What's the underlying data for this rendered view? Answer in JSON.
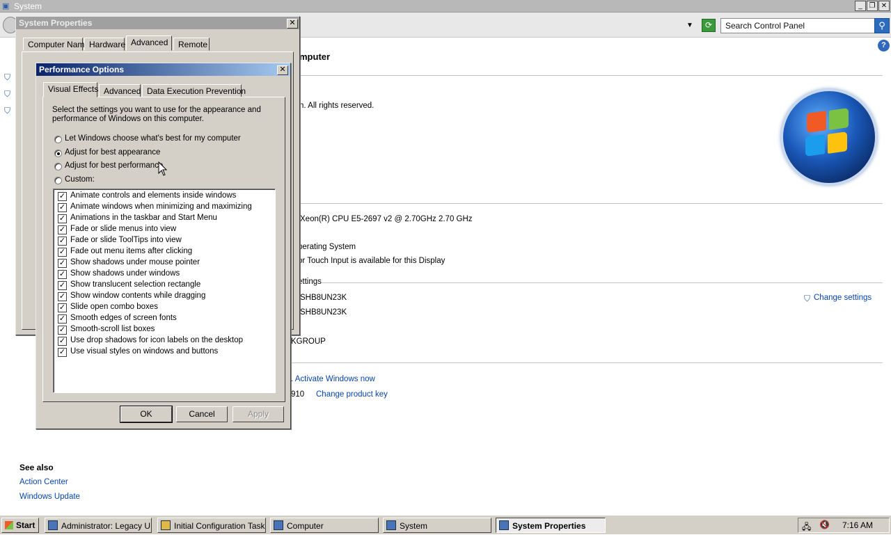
{
  "system_window": {
    "title": "System",
    "minimize_glyph": "_",
    "maximize_glyph": "❐",
    "close_glyph": "✕",
    "search_placeholder": "Search Control Panel",
    "header_fragment": "mputer",
    "copyright_fragment": "n.  All rights reserved.",
    "processor_fragment": "Xeon(R) CPU E5-2697 v2 @ 2.70GHz   2.70 GHz",
    "os_type_fragment": "perating System",
    "pen_touch_fragment": "or Touch Input is available for this Display",
    "settings_fragment": "ettings",
    "computer_name_fragment": "SHB8UN23K",
    "full_name_fragment": "SHB8UN23K",
    "workgroup_fragment": "KGROUP",
    "change_settings": "Change settings",
    "activate_fragment": ". Activate Windows now",
    "product_id_fragment": "910",
    "change_product_key": "Change product key",
    "see_also": "See also",
    "action_center": "Action Center",
    "windows_update": "Windows Update"
  },
  "system_properties": {
    "title": "System Properties",
    "tabs": [
      "Computer Name",
      "Hardware",
      "Advanced",
      "Remote"
    ],
    "selected_tab": "Advanced"
  },
  "performance_options": {
    "title": "Performance Options",
    "tabs": [
      "Visual Effects",
      "Advanced",
      "Data Execution Prevention"
    ],
    "selected_tab": "Visual Effects",
    "description": "Select the settings you want to use for the appearance and performance of Windows on this computer.",
    "radios": [
      {
        "label": "Let Windows choose what's best for my computer",
        "checked": false
      },
      {
        "label": "Adjust for best appearance",
        "checked": true
      },
      {
        "label": "Adjust for best performance",
        "checked": false
      },
      {
        "label": "Custom:",
        "checked": false
      }
    ],
    "effects": [
      {
        "label": "Animate controls and elements inside windows",
        "checked": true
      },
      {
        "label": "Animate windows when minimizing and maximizing",
        "checked": true
      },
      {
        "label": "Animations in the taskbar and Start Menu",
        "checked": true
      },
      {
        "label": "Fade or slide menus into view",
        "checked": true
      },
      {
        "label": "Fade or slide ToolTips into view",
        "checked": true
      },
      {
        "label": "Fade out menu items after clicking",
        "checked": true
      },
      {
        "label": "Show shadows under mouse pointer",
        "checked": true
      },
      {
        "label": "Show shadows under windows",
        "checked": true
      },
      {
        "label": "Show translucent selection rectangle",
        "checked": true
      },
      {
        "label": "Show window contents while dragging",
        "checked": true
      },
      {
        "label": "Slide open combo boxes",
        "checked": true
      },
      {
        "label": "Smooth edges of screen fonts",
        "checked": true
      },
      {
        "label": "Smooth-scroll list boxes",
        "checked": true
      },
      {
        "label": "Use drop shadows for icon labels on the desktop",
        "checked": true
      },
      {
        "label": "Use visual styles on windows and buttons",
        "checked": true
      }
    ],
    "ok": "OK",
    "cancel": "Cancel",
    "apply": "Apply"
  },
  "taskbar": {
    "start": "Start",
    "tasks": [
      {
        "label": "Administrator: Legacy U...",
        "active": false
      },
      {
        "label": "Initial Configuration Tasks",
        "active": false
      },
      {
        "label": "Computer",
        "active": false
      },
      {
        "label": "System",
        "active": false
      },
      {
        "label": "System Properties",
        "active": true
      }
    ],
    "clock": "7:16 AM"
  }
}
